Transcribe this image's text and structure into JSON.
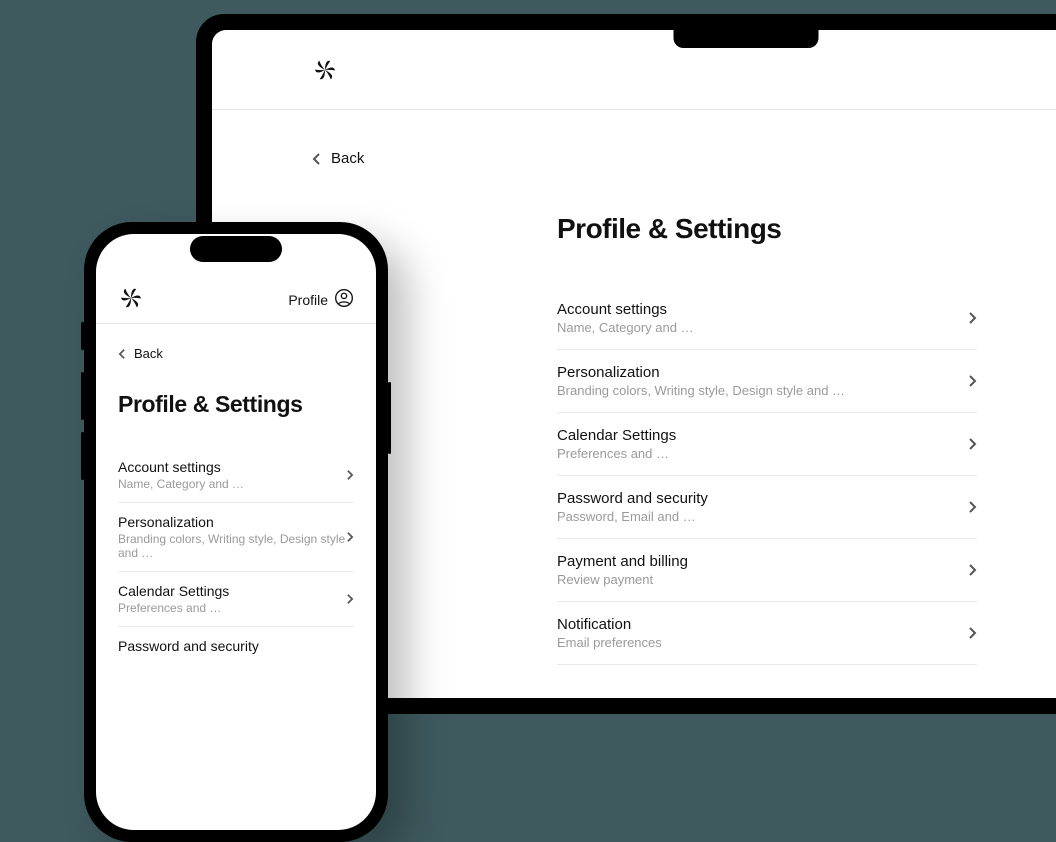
{
  "back_label": "Back",
  "page_title": "Profile & Settings",
  "phone_header": {
    "profile_label": "Profile"
  },
  "settings": [
    {
      "title": "Account settings",
      "desc": "Name, Category and …"
    },
    {
      "title": "Personalization",
      "desc": "Branding colors, Writing style, Design style and …"
    },
    {
      "title": "Calendar Settings",
      "desc": "Preferences and …"
    },
    {
      "title": "Password and security",
      "desc": "Password, Email and …"
    },
    {
      "title": "Payment and billing",
      "desc": "Review payment"
    },
    {
      "title": "Notification",
      "desc": "Email preferences"
    }
  ]
}
